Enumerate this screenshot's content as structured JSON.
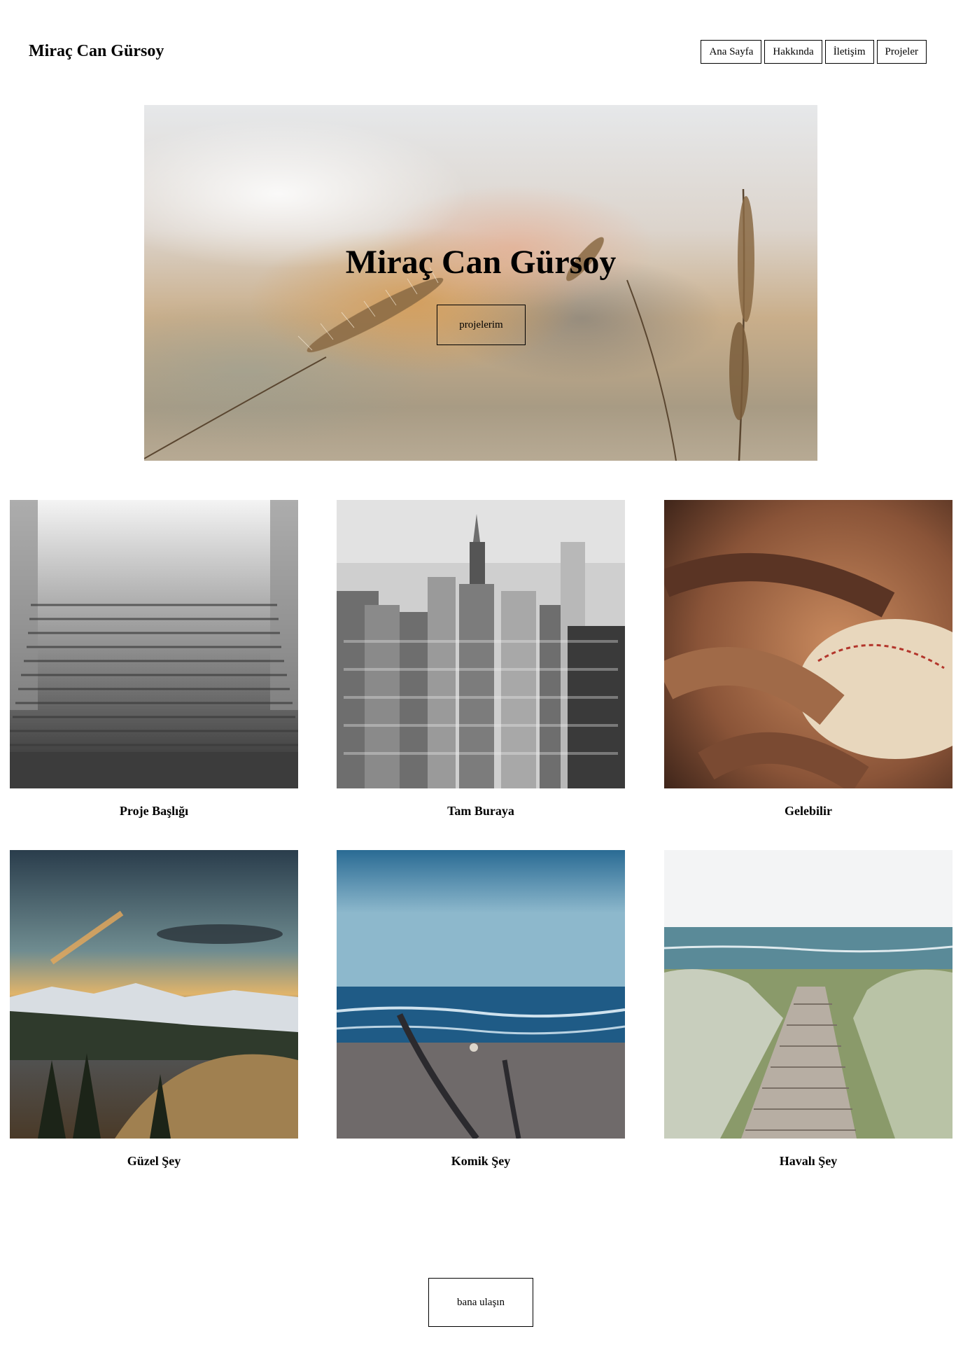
{
  "header": {
    "title": "Miraç Can Gürsoy",
    "nav": [
      "Ana Sayfa",
      "Hakkında",
      "İletişim",
      "Projeler"
    ]
  },
  "hero": {
    "title": "Miraç Can Gürsoy",
    "button": "projelerim"
  },
  "projects": [
    {
      "title": "Proje Başlığı",
      "image": "foggy-stairs-photo"
    },
    {
      "title": "Tam Buraya",
      "image": "city-skyline-photo"
    },
    {
      "title": "Gelebilir",
      "image": "baseball-glove-photo"
    },
    {
      "title": "Güzel Şey",
      "image": "mountain-sunset-photo"
    },
    {
      "title": "Komik Şey",
      "image": "beach-photo"
    },
    {
      "title": "Havalı Şey",
      "image": "boardwalk-photo"
    }
  ],
  "footer": {
    "contact_button": "bana ulaşın"
  }
}
